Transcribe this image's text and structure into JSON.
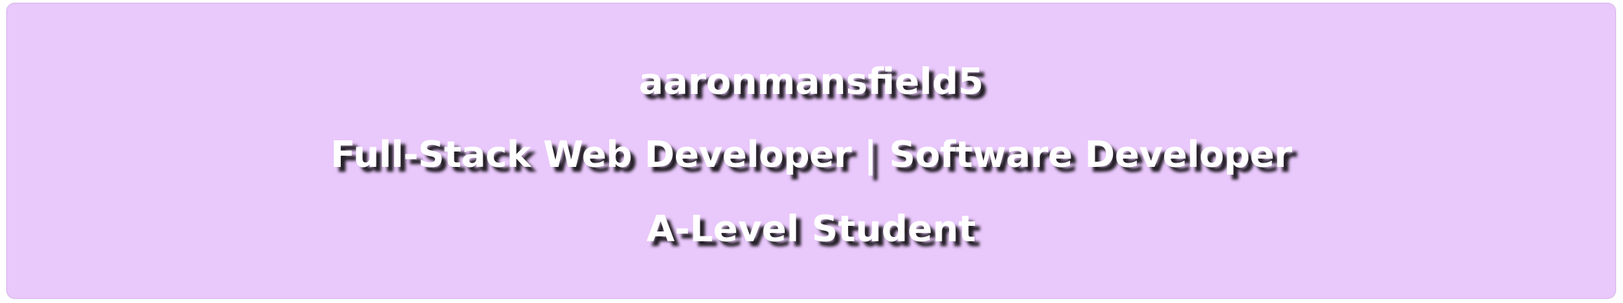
{
  "banner": {
    "username": "aaronmansfield5",
    "role": "Full-Stack Web Developer | Software Developer",
    "status": "A-Level Student",
    "colors": {
      "background": "#e9c8fb",
      "text": "#ffffff",
      "shadow": "#000000"
    }
  }
}
